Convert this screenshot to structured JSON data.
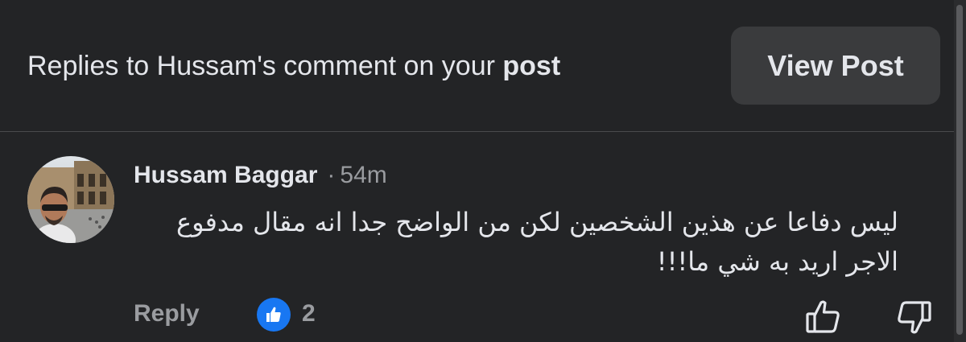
{
  "header": {
    "title_prefix": "Replies to Hussam's comment on your ",
    "title_bold": "post",
    "view_post_label": "View Post"
  },
  "comment": {
    "author": "Hussam Baggar",
    "separator": "·",
    "time": "54m",
    "text": "ليس دفاعا عن هذين الشخصين لكن من الواضح جدا انه مقال مدفوع الاجر اريد به شي ما!!!",
    "reply_label": "Reply",
    "reaction_count": "2",
    "avatar_icon": "profile-photo",
    "reaction_icon": "like-icon"
  },
  "actions": {
    "upvote_icon": "thumbs-up-icon",
    "downvote_icon": "thumbs-down-icon"
  },
  "colors": {
    "background": "#232426",
    "button_bg": "#3a3b3d",
    "text_primary": "#e4e6eb",
    "text_secondary": "#9a9ca0",
    "like_blue": "#1877f2"
  }
}
